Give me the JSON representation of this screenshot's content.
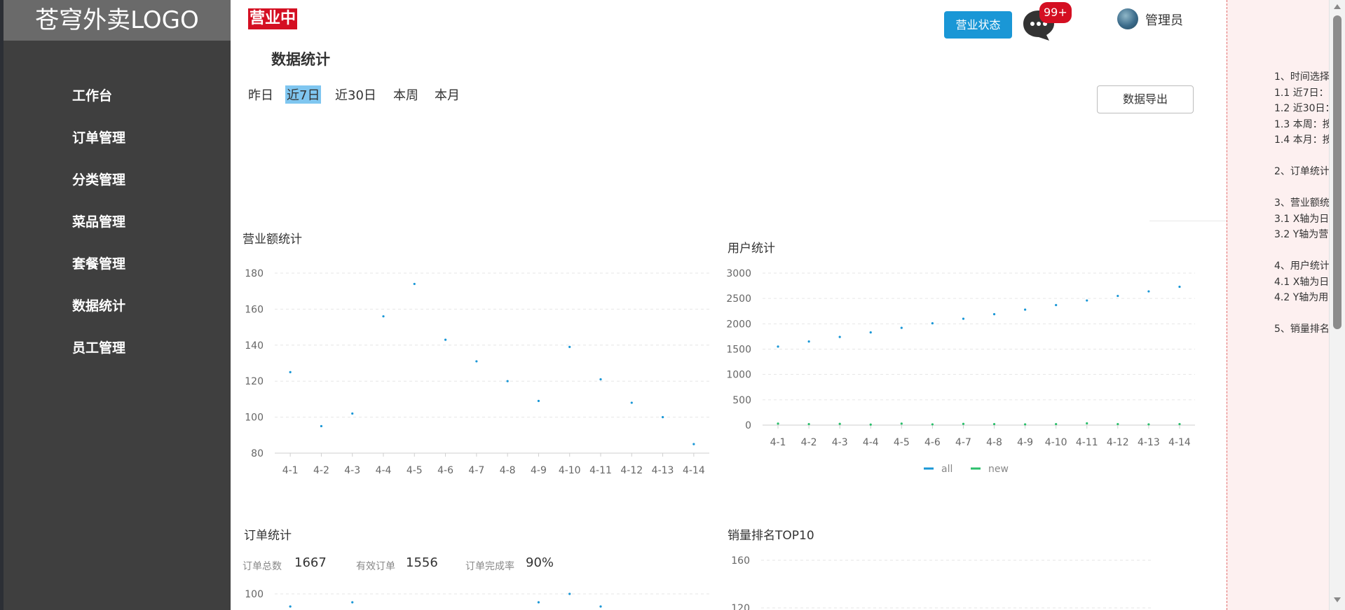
{
  "sidebar": {
    "logo": "苍穹外卖LOGO",
    "items": [
      {
        "label": "工作台"
      },
      {
        "label": "订单管理"
      },
      {
        "label": "分类管理"
      },
      {
        "label": "菜品管理"
      },
      {
        "label": "套餐管理"
      },
      {
        "label": "数据统计"
      },
      {
        "label": "员工管理"
      }
    ]
  },
  "header": {
    "status_tag": "营业中",
    "status_button": "营业状态",
    "message_badge": "99+",
    "user_name": "管理员",
    "icons": {
      "chat": "chat-bubble-icon",
      "avatar": "avatar-image"
    }
  },
  "page": {
    "title": "数据统计",
    "tabs": [
      {
        "label": "昨日",
        "active": false
      },
      {
        "label": "近7日",
        "active": true
      },
      {
        "label": "近30日",
        "active": false
      },
      {
        "label": "本周",
        "active": false
      },
      {
        "label": "本月",
        "active": false
      }
    ],
    "export_button": "数据导出"
  },
  "stats": {
    "total_label": "订单总数",
    "total_value": "1667",
    "valid_label": "有效订单",
    "valid_value": "1556",
    "rate_label": "订单完成率",
    "rate_value": "90%"
  },
  "chart_data": [
    {
      "type": "scatter",
      "title": "营业额统计",
      "x": [
        "4-1",
        "4-2",
        "4-3",
        "4-4",
        "4-5",
        "4-6",
        "4-7",
        "4-8",
        "4-9",
        "4-10",
        "4-11",
        "4-12",
        "4-13",
        "4-14"
      ],
      "y": [
        125,
        95,
        102,
        156,
        174,
        143,
        131,
        120,
        109,
        139,
        121,
        108,
        100,
        85
      ],
      "y_ticks": [
        180,
        160,
        140,
        120,
        100,
        80
      ],
      "ylim": [
        80,
        180
      ],
      "grid": true,
      "color": "#1a97d6"
    },
    {
      "type": "scatter",
      "title": "用户统计",
      "x": [
        "4-1",
        "4-2",
        "4-3",
        "4-4",
        "4-5",
        "4-6",
        "4-7",
        "4-8",
        "4-9",
        "4-10",
        "4-11",
        "4-12",
        "4-13",
        "4-14"
      ],
      "series": [
        {
          "name": "all",
          "color": "#1a97d6",
          "values": [
            1550,
            1650,
            1740,
            1830,
            1920,
            2010,
            2100,
            2190,
            2280,
            2370,
            2460,
            2550,
            2640,
            2730
          ]
        },
        {
          "name": "new",
          "color": "#2bbf6b",
          "values": [
            30,
            20,
            25,
            10,
            30,
            15,
            25,
            20,
            15,
            20,
            35,
            20,
            15,
            20
          ]
        }
      ],
      "y_ticks": [
        3000,
        2500,
        2000,
        1500,
        1000,
        500,
        0
      ],
      "ylim": [
        0,
        3000
      ],
      "legend": "bottom-center",
      "grid": true
    },
    {
      "type": "scatter",
      "title": "订单统计",
      "y_ticks": [
        100
      ],
      "visible_points": [
        {
          "x_index": 0,
          "y": 97
        },
        {
          "x_index": 2,
          "y": 98
        },
        {
          "x_index": 8,
          "y": 98
        },
        {
          "x_index": 9,
          "y": 100
        },
        {
          "x_index": 10,
          "y": 97
        }
      ],
      "grid": true,
      "color": "#1a97d6"
    },
    {
      "type": "bar",
      "title": "销量排名TOP10",
      "y_ticks": [
        160,
        120
      ],
      "grid": true
    }
  ],
  "notes": {
    "lines": [
      "1、时间选择",
      "1.1 近7日：",
      "1.2 近30日：",
      "1.3 本周：按",
      "1.4 本月：按",
      "",
      "2、订单统计",
      "",
      "3、营业额统",
      "3.1 X轴为日",
      "3.2 Y轴为营",
      "",
      "4、用户统计",
      "4.1 X轴为日",
      "4.2 Y轴为用",
      "",
      "5、销量排名"
    ]
  }
}
